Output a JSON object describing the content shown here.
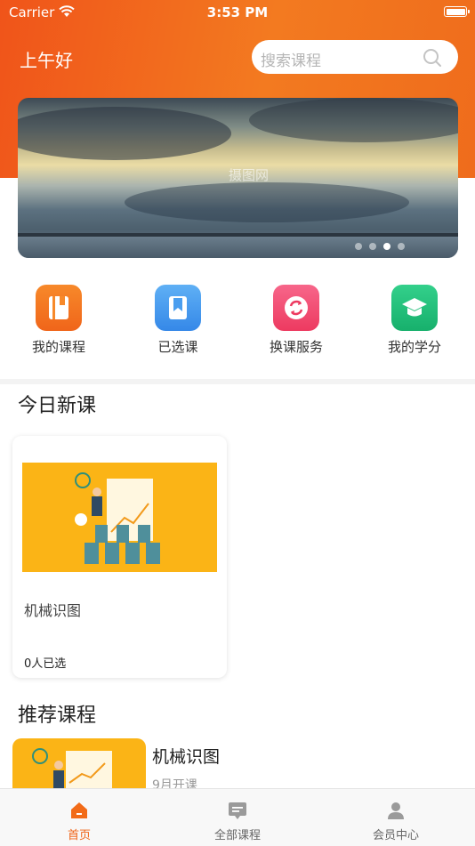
{
  "status_bar": {
    "carrier": "Carrier",
    "time": "3:53 PM"
  },
  "header": {
    "greeting": "上午好",
    "search_placeholder": "搜索课程"
  },
  "banner": {
    "watermark": "摄图网",
    "page_count": 4,
    "active_page": 3
  },
  "menu": [
    {
      "label": "我的课程",
      "icon": "book-icon",
      "color": "#f47a1f"
    },
    {
      "label": "已选课",
      "icon": "bookmark-icon",
      "color": "#3e98ee"
    },
    {
      "label": "换课服务",
      "icon": "swap-icon",
      "color": "#f0456c"
    },
    {
      "label": "我的学分",
      "icon": "graduation-cap-icon",
      "color": "#23c07a"
    }
  ],
  "today_section": {
    "title": "今日新课",
    "card": {
      "name": "机械识图",
      "enrolled": "0人已选"
    }
  },
  "recommend_section": {
    "title": "推荐课程",
    "item": {
      "name": "机械识图",
      "start": "9月开课"
    }
  },
  "tabbar": [
    {
      "label": "首页",
      "icon": "home-icon",
      "active": true
    },
    {
      "label": "全部课程",
      "icon": "courses-icon",
      "active": false
    },
    {
      "label": "会员中心",
      "icon": "user-icon",
      "active": false
    }
  ],
  "colors": {
    "brand": "#ef6418",
    "thumb_bg": "#fbb416"
  }
}
